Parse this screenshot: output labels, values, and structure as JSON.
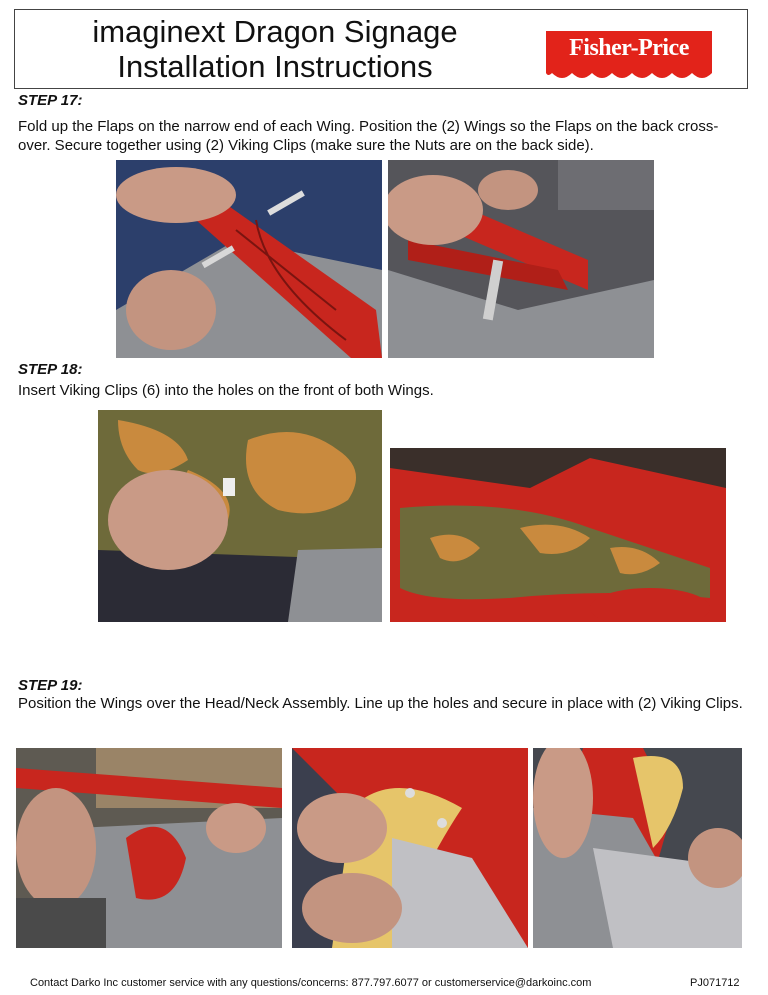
{
  "header": {
    "title_line1": "imaginext Dragon Signage",
    "title_line2": "Installation Instructions",
    "logo_text": "Fisher-Price"
  },
  "steps": [
    {
      "label": "STEP 17:",
      "text": "Fold up the Flaps on the narrow end of each Wing. Position the (2) Wings so the Flaps on the back cross-over. Secure together using (2) Viking Clips (make sure the Nuts are on the back side)."
    },
    {
      "label": "STEP 18:",
      "text": "Insert Viking Clips (6) into the holes on the front of both Wings."
    },
    {
      "label": "STEP 19:",
      "text": "Position the Wings over the Head/Neck Assembly. Line up the holes and secure in place with (2) Viking Clips."
    }
  ],
  "footer": {
    "contact": "Contact Darko Inc customer service with any questions/concerns: 877.797.6077 or customerservice@darkoinc.com",
    "code": "PJ071712"
  },
  "colors": {
    "brand_red": "#e2231a",
    "wing_red": "#c8261e",
    "wing_gold": "#c98a3e",
    "wing_olive": "#6e6a3a",
    "panel_gray": "#8e9094",
    "floor_blue": "#2c3f6b"
  }
}
